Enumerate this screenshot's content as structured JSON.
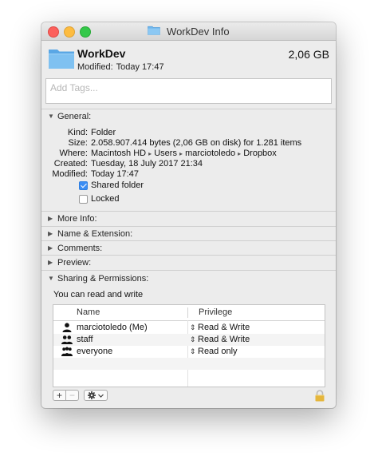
{
  "window": {
    "title": "WorkDev Info"
  },
  "header": {
    "name": "WorkDev",
    "modified_label": "Modified:",
    "modified_value": "Today 17:47",
    "size": "2,06 GB"
  },
  "tags": {
    "placeholder": "Add Tags..."
  },
  "general": {
    "title": "General:",
    "kind_label": "Kind:",
    "kind": "Folder",
    "size_label": "Size:",
    "size": "2.058.907.414 bytes (2,06 GB on disk) for 1.281 items",
    "where_label": "Where:",
    "where": [
      "Macintosh HD",
      "Users",
      "marciotoledo",
      "Dropbox"
    ],
    "created_label": "Created:",
    "created": "Tuesday, 18 July 2017 21:34",
    "modified_label": "Modified:",
    "modified": "Today 17:47",
    "shared_folder_label": "Shared folder",
    "shared_folder_checked": true,
    "locked_label": "Locked",
    "locked_checked": false
  },
  "sections": {
    "more_info": "More Info:",
    "name_extension": "Name & Extension:",
    "comments": "Comments:",
    "preview": "Preview:",
    "sharing": "Sharing & Permissions:"
  },
  "permissions": {
    "note": "You can read and write",
    "columns": {
      "name": "Name",
      "privilege": "Privilege"
    },
    "rows": [
      {
        "name": "marciotoledo (Me)",
        "privilege": "Read & Write",
        "icon": "user-icon"
      },
      {
        "name": "staff",
        "privilege": "Read & Write",
        "icon": "group-icon"
      },
      {
        "name": "everyone",
        "privilege": "Read only",
        "icon": "everyone-icon"
      }
    ]
  },
  "toolbar": {
    "add": "+",
    "remove": "−",
    "action_icon": "gear-icon",
    "lock_icon": "lock-icon"
  },
  "colors": {
    "accent": "#3b8df3",
    "close": "#fc605c",
    "minimize": "#fdbc40",
    "zoom": "#34c84a",
    "folder": "#6fb6ec",
    "lock": "#e5b63c"
  }
}
